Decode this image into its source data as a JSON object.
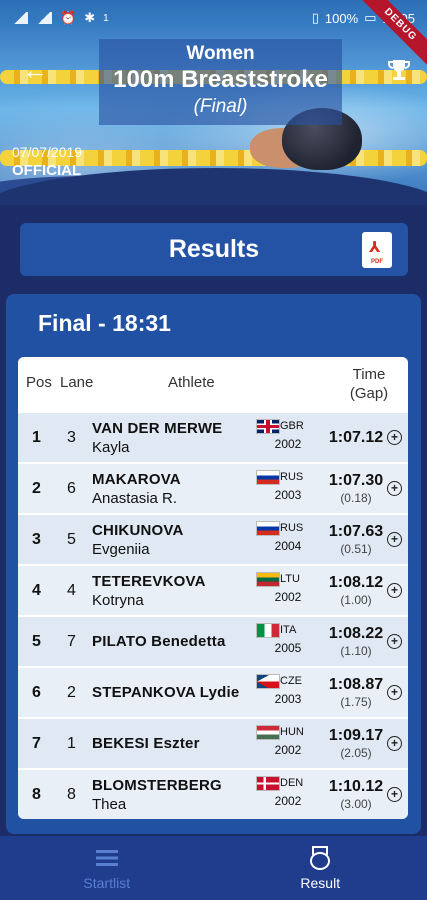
{
  "status_bar": {
    "battery": "100%",
    "time": "14:05",
    "debug": "DEBUG",
    "notif_count": "1"
  },
  "header": {
    "gender": "Women",
    "event": "100m Breaststroke",
    "phase": "(Final)",
    "date": "07/07/2019",
    "status": "OFFICIAL"
  },
  "results_bar": {
    "label": "Results",
    "pdf_label": "PDF"
  },
  "panel": {
    "title": "Final - 18:31"
  },
  "table": {
    "headers": {
      "pos": "Pos",
      "lane": "Lane",
      "athlete": "Athlete",
      "time": "Time",
      "gap": "(Gap)"
    },
    "rows": [
      {
        "pos": "1",
        "lane": "3",
        "last": "VAN DER MERWE",
        "first": "Kayla",
        "noc": "GBR",
        "flag": "gbr",
        "year": "2002",
        "time": "1:07.12",
        "gap": ""
      },
      {
        "pos": "2",
        "lane": "6",
        "last": "MAKAROVA",
        "first": "Anastasia R.",
        "noc": "RUS",
        "flag": "rus",
        "year": "2003",
        "time": "1:07.30",
        "gap": "(0.18)"
      },
      {
        "pos": "3",
        "lane": "5",
        "last": "CHIKUNOVA",
        "first": "Evgeniia",
        "noc": "RUS",
        "flag": "rus",
        "year": "2004",
        "time": "1:07.63",
        "gap": "(0.51)"
      },
      {
        "pos": "4",
        "lane": "4",
        "last": "TETEREVKOVA",
        "first": "Kotryna",
        "noc": "LTU",
        "flag": "ltu",
        "year": "2002",
        "time": "1:08.12",
        "gap": "(1.00)"
      },
      {
        "pos": "5",
        "lane": "7",
        "last": "PILATO Benedetta",
        "first": "",
        "noc": "ITA",
        "flag": "ita",
        "year": "2005",
        "time": "1:08.22",
        "gap": "(1.10)"
      },
      {
        "pos": "6",
        "lane": "2",
        "last": "STEPANKOVA Lydie",
        "first": "",
        "noc": "CZE",
        "flag": "cze",
        "year": "2003",
        "time": "1:08.87",
        "gap": "(1.75)"
      },
      {
        "pos": "7",
        "lane": "1",
        "last": "BEKESI Eszter",
        "first": "",
        "noc": "HUN",
        "flag": "hun",
        "year": "2002",
        "time": "1:09.17",
        "gap": "(2.05)"
      },
      {
        "pos": "8",
        "lane": "8",
        "last": "BLOMSTERBERG",
        "first": "Thea",
        "noc": "DEN",
        "flag": "den",
        "year": "2002",
        "time": "1:10.12",
        "gap": "(3.00)"
      }
    ]
  },
  "bottom_nav": {
    "items": [
      {
        "label": "Startlist",
        "icon": "list-icon",
        "active": false
      },
      {
        "label": "Result",
        "icon": "medal-icon",
        "active": true
      }
    ]
  }
}
